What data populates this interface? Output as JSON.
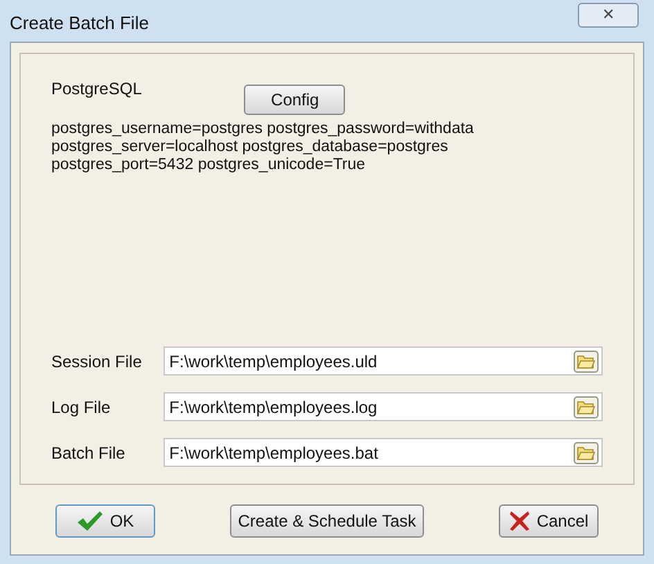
{
  "window": {
    "title": "Create Batch File",
    "close": "✕"
  },
  "database": {
    "name": "PostgreSQL",
    "config_button": "Config",
    "settings": [
      "postgres_username=postgres postgres_password=withdata",
      "postgres_server=localhost postgres_database=postgres",
      "postgres_port=5432 postgres_unicode=True"
    ]
  },
  "files": [
    {
      "label": "Session File",
      "value": "F:\\work\\temp\\employees.uld"
    },
    {
      "label": "Log File",
      "value": "F:\\work\\temp\\employees.log"
    },
    {
      "label": "Batch File",
      "value": "F:\\work\\temp\\employees.bat"
    }
  ],
  "buttons": [
    {
      "kind": "ok",
      "label": "OK"
    },
    {
      "kind": "plain",
      "label": "Create & Schedule Task"
    },
    {
      "kind": "cancel",
      "label": "Cancel"
    }
  ]
}
